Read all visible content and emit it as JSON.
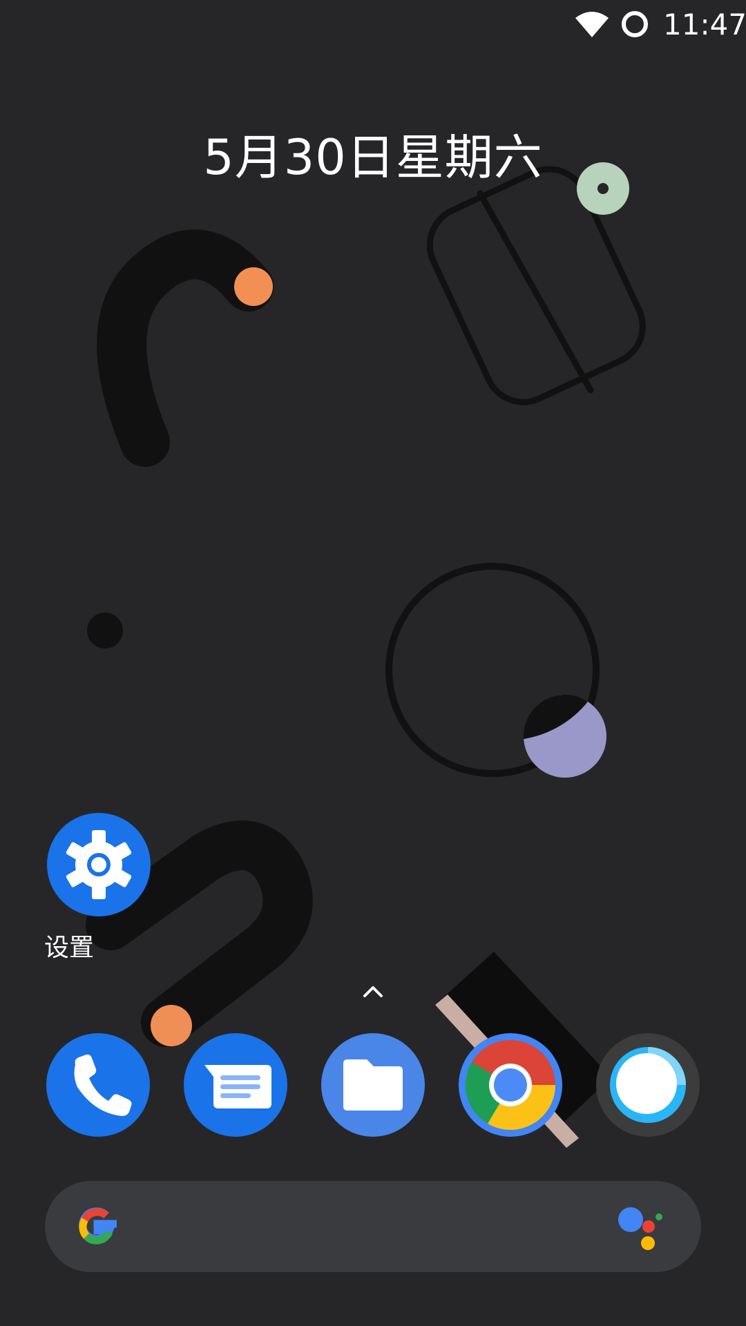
{
  "status_bar": {
    "time": "11:47",
    "wifi_icon": "wifi-icon",
    "battery_icon": "battery-icon"
  },
  "date_widget": {
    "text": "5月30日星期六"
  },
  "workspace": {
    "apps": [
      {
        "label": "设置",
        "icon": "gear-icon",
        "color": "#1a73e8"
      }
    ]
  },
  "dock": {
    "apps": [
      {
        "icon": "phone-icon",
        "color": "#1a73e8"
      },
      {
        "icon": "messages-icon",
        "color": "#1a73e8"
      },
      {
        "icon": "folder-icon",
        "color": "#4a86e8"
      },
      {
        "icon": "chrome-icon",
        "color": "#4285f4"
      },
      {
        "icon": "camera-icon",
        "color": "#3c3c3c"
      }
    ]
  },
  "search_bar": {
    "logo_icon": "google-g-icon",
    "assistant_icon": "assistant-icon"
  },
  "colors": {
    "background": "#262628",
    "search_bar": "#3a3b3f",
    "accent_orange": "#f0915a",
    "accent_green": "#b7d3bb",
    "accent_purple": "#9a98c8"
  }
}
